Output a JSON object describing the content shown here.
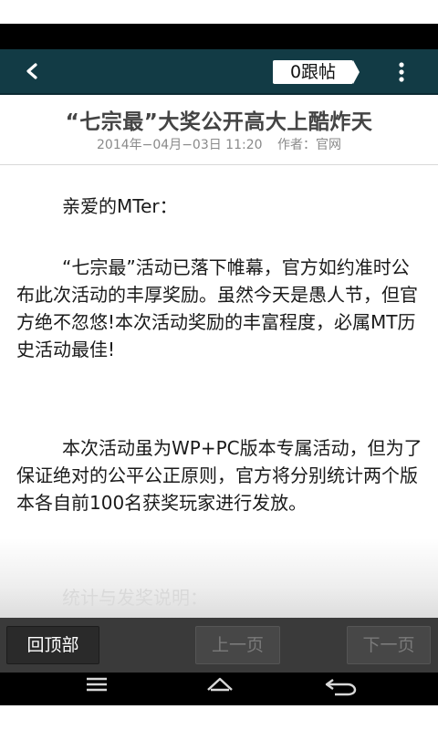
{
  "app_bar": {
    "back_icon": "chevron-left-icon",
    "reply_count": "0跟帖",
    "menu_icon": "vertical-dots-icon"
  },
  "article": {
    "title": "“七宗最”大奖公开高大上酷炸天",
    "date": "2014年−04月−03日 11:20",
    "author": "作者：官网",
    "paragraphs": [
      "亲爱的MTer：",
      "“七宗最”活动已落下帷幕，官方如约准时公布此次活动的丰厚奖励。虽然今天是愚人节，但官方绝不忽悠!本次活动奖励的丰富程度，必属MT历史活动最佳!",
      "本次活动虽为WP+PC版本专属活动，但为了保证绝对的公平公正原则，官方将分别统计两个版本各自前100名获奖玩家进行发放。",
      "统计与发奖说明："
    ]
  },
  "bottom_bar": {
    "back_to_top": "回顶部",
    "prev_page": "上一页",
    "next_page": "下一页"
  },
  "system_nav": {
    "recents_icon": "menu-lines-icon",
    "home_icon": "home-icon",
    "back_icon": "back-arrow-icon"
  },
  "colors": {
    "app_bar": "#123b45",
    "bottom_bar": "#3a3a3a",
    "text": "#1a1a1a",
    "meta": "#8a8a8a"
  }
}
